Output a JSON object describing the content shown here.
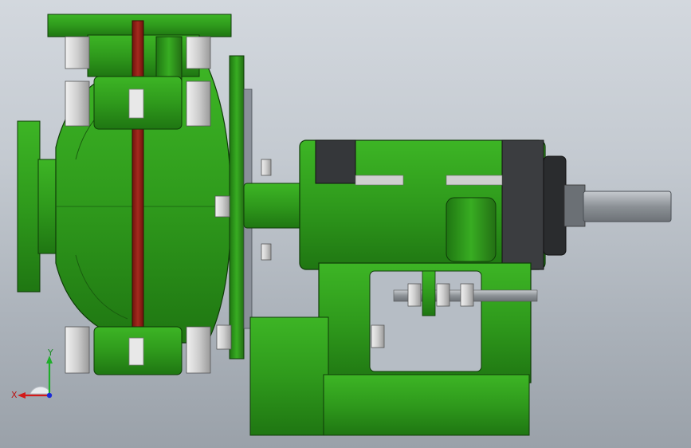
{
  "viewport": {
    "background_top": "#d3d8de",
    "background_bottom": "#9aa1a9"
  },
  "model": {
    "body_color": "#2f9a1c",
    "body_dark": "#1f6e12",
    "liner_color": "#8f1d14",
    "bolt_color": "#dcdcdc",
    "shaft_color": "#9ea3a8",
    "bearing_color": "#3b3d40"
  },
  "triad": {
    "x_label": "X",
    "y_label": "Y",
    "x_color": "#d21a1a",
    "y_color": "#1fae2a",
    "z_color": "#1a2ad6"
  }
}
